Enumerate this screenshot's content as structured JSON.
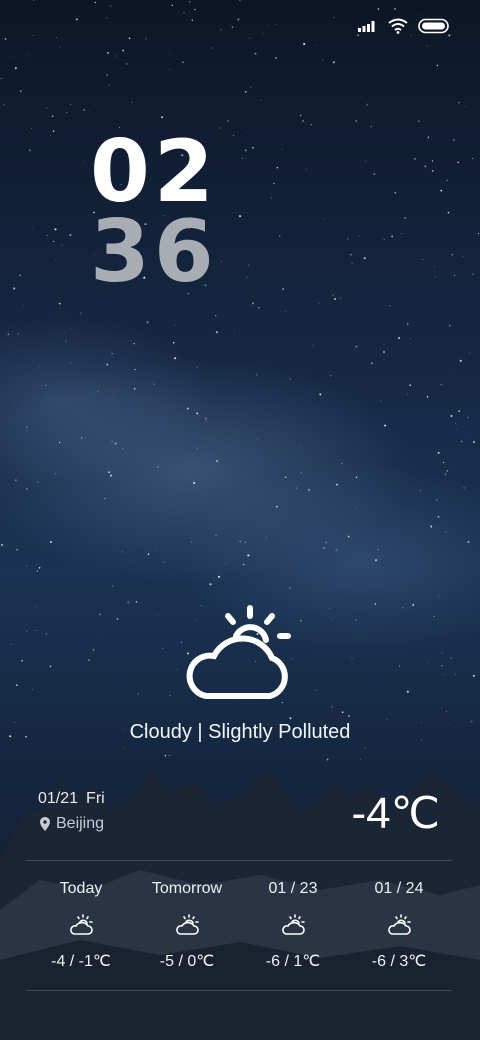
{
  "status_bar": {
    "icons": [
      "signal-icon",
      "wifi-icon",
      "battery-icon"
    ]
  },
  "clock": {
    "hours": "02",
    "minutes": "36"
  },
  "current": {
    "icon": "partly-cloudy-icon",
    "condition": "Cloudy | Slightly Polluted",
    "date": "01/21",
    "weekday": "Fri",
    "location": "Beijing",
    "temperature": "-4℃"
  },
  "forecast": [
    {
      "label": "Today",
      "icon": "partly-cloudy-icon",
      "temp": "-4 / -1℃"
    },
    {
      "label": "Tomorrow",
      "icon": "partly-cloudy-icon",
      "temp": "-5 / 0℃"
    },
    {
      "label": "01 / 23",
      "icon": "partly-cloudy-icon",
      "temp": "-6 / 1℃"
    },
    {
      "label": "01 / 24",
      "icon": "partly-cloudy-icon",
      "temp": "-6 / 3℃"
    }
  ]
}
